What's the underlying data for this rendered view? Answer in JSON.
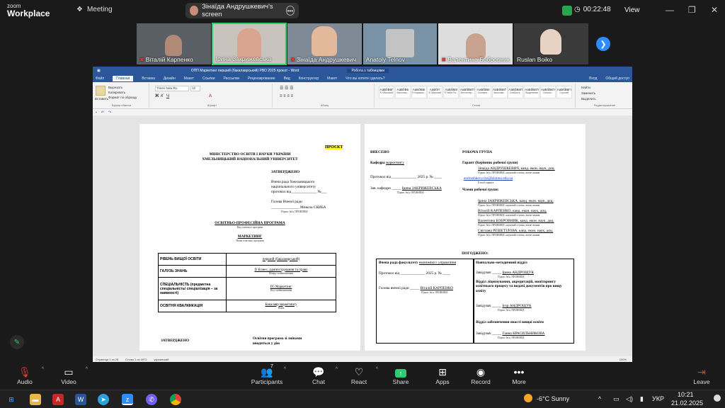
{
  "app": {
    "logo_line1": "zoom",
    "logo_line2": "Workplace",
    "meeting_label": "Meeting"
  },
  "share_indicator": {
    "label": "Зінаїда Андрушкевич's screen"
  },
  "top_right": {
    "timer": "00:22:48",
    "view_label": "View"
  },
  "participants_gallery": [
    {
      "name": "Віталій Карпенко",
      "muted": true
    },
    {
      "name": "Ірина Закрижевська",
      "muted": false,
      "active": true
    },
    {
      "name": "Зінаїда Андрушкевич",
      "muted": true
    },
    {
      "name": "Anatoly Telnov",
      "muted": false
    },
    {
      "name": "Валентина Бобровник",
      "muted": true
    },
    {
      "name": "Ruslan Boiko",
      "muted": false
    }
  ],
  "word": {
    "title": "ОПП Маркетинг перший (бакалаврський) РВО 2025 проєкт - Word",
    "tools_label": "Робота з таблицями",
    "tabs": [
      "Файл",
      "Главная",
      "Вставка",
      "Дизайн",
      "Макет",
      "Ссылки",
      "Рассылки",
      "Рецензирование",
      "Вид",
      "Конструктор",
      "Макет",
      "Что вы хотите сделать?"
    ],
    "font_name": "Times New Ro",
    "font_size": "12",
    "clipboard": {
      "paste": "Вставить",
      "cut": "Вырезать",
      "copy": "Копировать",
      "format": "Формат по образцу"
    },
    "group_labels": {
      "clipboard": "Буфер обмена",
      "font": "Шрифт",
      "paragraph": "Абзац",
      "styles": "Стили",
      "editing": "Редактирование"
    },
    "styles": [
      {
        "sample": "АаБбВвГ",
        "name": "¶ Обычный"
      },
      {
        "sample": "АаБбВв",
        "name": "Заголово..."
      },
      {
        "sample": "АаБбВвI",
        "name": "¶ Нормаль..."
      },
      {
        "sample": "АаБбГг",
        "name": "¶ Обычный"
      },
      {
        "sample": "АаБбВвI",
        "name": "¶ Table Pa..."
      },
      {
        "sample": "АаБбВвГг",
        "name": "Без интер..."
      },
      {
        "sample": "АаБбВвI",
        "name": "Основно..."
      },
      {
        "sample": "АаБбВвГ",
        "name": "Заголово..."
      },
      {
        "sample": "АаБбВвГг",
        "name": "Слабое в..."
      },
      {
        "sample": "АаБбВвГг",
        "name": "Выделение"
      },
      {
        "sample": "АаБбВвГг",
        "name": "Сильно..."
      },
      {
        "sample": "АаБбВвГг",
        "name": "Строгий"
      }
    ],
    "editing": {
      "find": "Найти",
      "replace": "Заменить",
      "select": "Выделить"
    },
    "user": "Вход",
    "share": "Общий доступ",
    "status": {
      "page": "Страница 1 из 28",
      "words": "Слово 1 из 4972",
      "lang": "украинский",
      "zoom": "100%"
    }
  },
  "doc_left": {
    "project_tag": "ПРОЄКТ",
    "ministry": "МІНІСТЕРСТВО ОСВІТИ І НАУКИ УКРАЇНИ",
    "university": "ХМЕЛЬНИЦЬКИЙ НАЦІОНАЛЬНИЙ УНІВЕРСИТЕТ",
    "approved": "ЗАТВЕРДЖЕНО",
    "council_1": "Вчена рада Хмельницького",
    "council_2": "національного університету",
    "protocol": "протокол від _____________ №___",
    "head": "Голова Вченої ради",
    "head_sign": "_______________ Микола СКИБА",
    "sign_caption": "Підпис                    Ім'я, ПРІЗВИЩЕ",
    "program_type": "ОСВІТНЬО-ПРОФЕСІЙНА ПРОГРАМА",
    "program_type_caption": "Вид освітньої програми",
    "program_name": "МАРКЕТИНГ",
    "program_name_caption": "Назва освітньої програми",
    "table": [
      {
        "label": "РІВЕНЬ ВИЩОЇ ОСВІТИ",
        "value": "перший (бакалаврський)",
        "caption": ""
      },
      {
        "label": "ГАЛУЗЬ ЗНАНЬ",
        "value": "D Бізнес, адміністрування та право",
        "caption": "Шифр і найменування"
      },
      {
        "label": "СПЕЦІАЛЬНІСТЬ (предметна спеціальність/ спеціалізація – за наявності)",
        "value": "D5 Маркетинг",
        "caption": "Код і найменування"
      },
      {
        "label": "ОСВІТНЯ КВАЛІФІКАЦІЯ",
        "value": "Бакалавр маркетингу",
        "caption": "Назва"
      }
    ],
    "footer_approved": "ЗАТВЕРДЖЕНО",
    "footer_note_1": "Освітня програма зі змінами",
    "footer_note_2": "вводиться у дію"
  },
  "doc_right": {
    "submitted": "ВНЕСЕНО",
    "department_label": "Кафедра",
    "department": "маркетингу",
    "protocol": "Протокол від _____________ 2025 р. № ____",
    "head_label": "Зав. кафедри",
    "head_name": "Ірина ЗАКРИЖЕВСЬКА",
    "sign_caption": "Підпис           Ім'я, ПРІЗВИЩЕ",
    "working_group": "РОБОЧА ГРУПА",
    "guarantor": "Гарант (Керівник робочої групи)",
    "guarantor_name": "Зінаїда АНДРУШКЕВИЧ, канд. екон. наук, доц.",
    "guarantor_caption": "Підпис    Ім'я, ПРІЗВИЩЕ, науковий ступінь, вчене звання",
    "email": "andrushkevychz@khmnu.edu.ua",
    "email_caption": "E-mail гаранта",
    "members_label": "Члени робочої групи:",
    "members": [
      "Ірина ЗАКРИЖЕВСЬКА, канд. екон. наук, доц.",
      "Віталій КАРПЕНКО, канд. екон. наук, доц.",
      "Валентина БОБРОВНИК, канд. екон. наук, доц.",
      "Світлана РЕШЕТІЛОВА, канд. екон. наук, доц."
    ],
    "member_caption": "Підпис    Ім'я, ПРІЗВИЩЕ, науковий ступінь, вчене звання",
    "agreed": "ПОГОДЖЕНО:",
    "faculty_council": "Вчена рада факультету",
    "faculty": "економіки і управління",
    "fc_protocol": "Протокол від _____________ 2025 р. № ____",
    "fc_head_label": "Голова вченої ради",
    "fc_head_name": "Віталій КАРПЕНКО",
    "method_dept": "Навчально-методичний відділ",
    "manager_label": "Завідувач",
    "method_head": "Ірина АНДРОЩУК",
    "licensing_dept": "Відділ ліцензування, акредитацій, моніторингу освітнього процесу та видачі документів про вищу освіту",
    "licensing_head": "Ігор АНДРОЩУК",
    "quality_dept": "Відділ забезпечення якості вищої освіти",
    "quality_head": "Ганна КРАСИЛЬНИКОВА"
  },
  "toolbar": {
    "audio": "Audio",
    "video": "Video",
    "participants": "Participants",
    "participants_count": "7",
    "chat": "Chat",
    "react": "React",
    "share": "Share",
    "apps": "Apps",
    "record": "Record",
    "more": "More",
    "leave": "Leave"
  },
  "taskbar": {
    "weather": "-6°C  Sunny",
    "lang": "УКР",
    "time": "10:21",
    "date": "21.02.2025"
  },
  "colors": {
    "zoom_blue": "#2d8cff",
    "active_green": "#2ecc71",
    "word_blue": "#2b579a",
    "muted_red": "#e53935"
  }
}
